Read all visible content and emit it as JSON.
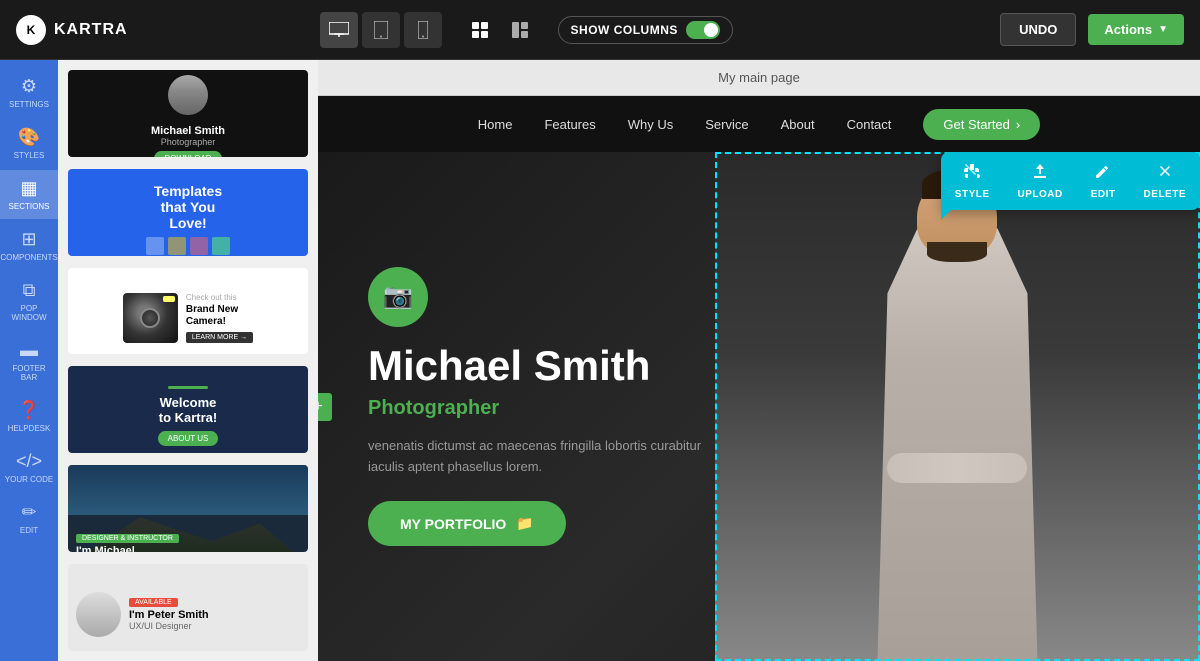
{
  "app": {
    "logo_text": "KARTRA",
    "logo_abbr": "K"
  },
  "toolbar": {
    "show_columns_label": "SHOW COLUMNS",
    "undo_label": "UNDO",
    "actions_label": "Actions"
  },
  "devices": [
    {
      "id": "desktop",
      "icon": "🖥",
      "active": true
    },
    {
      "id": "tablet",
      "icon": "📱",
      "active": false
    },
    {
      "id": "mobile",
      "icon": "📲",
      "active": false
    }
  ],
  "sidebar": {
    "items": [
      {
        "id": "styles",
        "icon": "◈",
        "label": "STYLES"
      },
      {
        "id": "sections",
        "icon": "▦",
        "label": "SECTIONS",
        "active": true
      },
      {
        "id": "components",
        "icon": "⊞",
        "label": "COMPONENTS"
      },
      {
        "id": "pop-window",
        "icon": "⧉",
        "label": "POP WINDOW"
      },
      {
        "id": "footer-bar",
        "icon": "▬",
        "label": "FOOTER BAR"
      },
      {
        "id": "helpdesk",
        "icon": "❓",
        "label": "HELPDESK"
      },
      {
        "id": "your-code",
        "icon": "</>",
        "label": "YOUR CODE"
      },
      {
        "id": "edit",
        "icon": "✏",
        "label": "EDIT"
      }
    ]
  },
  "page": {
    "label": "My main page"
  },
  "site_nav": {
    "links": [
      "Home",
      "Features",
      "Why Us",
      "Service",
      "About",
      "Contact"
    ],
    "cta_label": "Get Started",
    "cta_arrow": "›"
  },
  "hero": {
    "camera_icon": "📷",
    "name": "Michael Smith",
    "title": "Photographer",
    "description": "venenatis dictumst ac maecenas fringilla lobortis curabitur iaculis aptent phasellus lorem.",
    "portfolio_btn": "MY PORTFOLIO",
    "portfolio_icon": "📁"
  },
  "context_menu": {
    "items": [
      {
        "id": "style",
        "icon": "🖌",
        "label": "STYLE"
      },
      {
        "id": "upload",
        "icon": "⬆",
        "label": "UPLOAD"
      },
      {
        "id": "edit",
        "icon": "✏",
        "label": "EDIT"
      },
      {
        "id": "delete",
        "icon": "✕",
        "label": "DELETE"
      }
    ]
  },
  "templates": [
    {
      "id": "michael-dark",
      "type": "dark",
      "name": "Michael Smith",
      "subtitle": "Photographer"
    },
    {
      "id": "templates-blue",
      "type": "blue",
      "title": "Templates that You Love!"
    },
    {
      "id": "camera-white",
      "type": "white",
      "title": "Brand New Camera!"
    },
    {
      "id": "kartra-navy",
      "type": "navy",
      "title": "Welcome to Kartra!"
    },
    {
      "id": "landscape",
      "type": "landscape",
      "title": "I'm Michael",
      "subtitle": "Designer & Instructor"
    },
    {
      "id": "peter",
      "type": "peter",
      "title": "I'm Peter Smith",
      "subtitle": "UX/UI Designer"
    }
  ]
}
